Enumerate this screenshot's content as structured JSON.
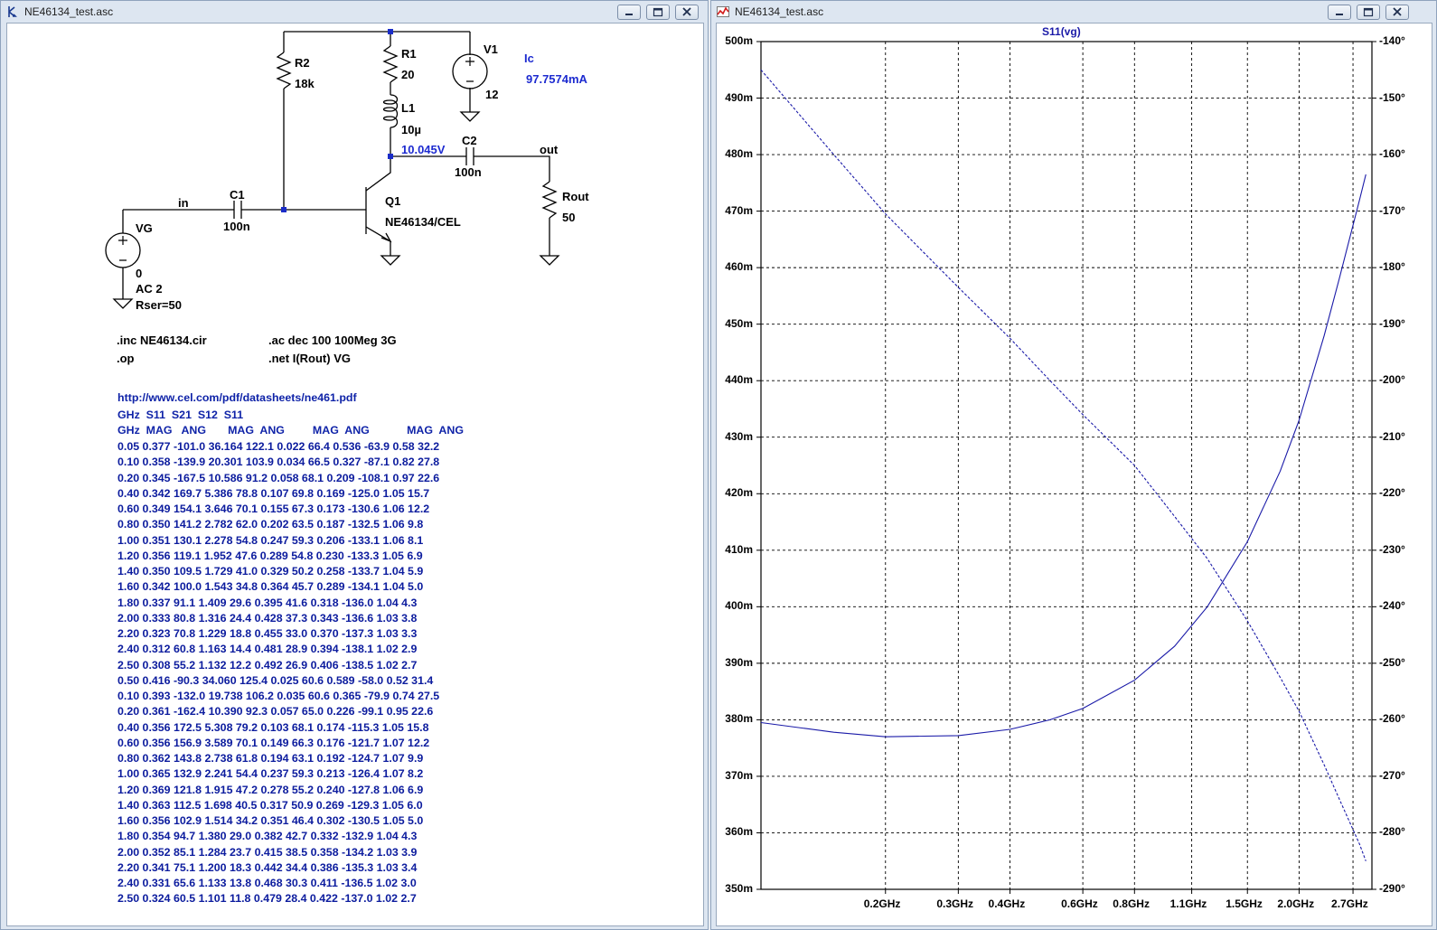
{
  "schematic_window": {
    "title": "NE46134_test.asc",
    "components": {
      "r2_name": "R2",
      "r2_value": "18k",
      "r1_name": "R1",
      "r1_value": "20",
      "v1_name": "V1",
      "v1_value": "12",
      "l1_name": "L1",
      "l1_value": "10µ",
      "c2_name": "C2",
      "c2_value": "100n",
      "c1_name": "C1",
      "c1_value": "100n",
      "q1_name": "Q1",
      "q1_model": "NE46134/CEL",
      "vg_name": "VG",
      "vg_value": "0",
      "vg_ac": "AC 2",
      "vg_rser": "Rser=50",
      "rout_name": "Rout",
      "rout_value": "50"
    },
    "net_labels": {
      "in": "in",
      "out": "out"
    },
    "op_annotations": {
      "ic_label": "Ic",
      "ic_value": "97.7574mA",
      "node_voltage": "10.045V"
    },
    "directives": {
      "inc": ".inc NE46134.cir",
      "op": ".op",
      "ac": ".ac dec 100 100Meg 3G",
      "net": ".net I(Rout) VG"
    },
    "comments": {
      "url": "http://www.cel.com/pdf/datasheets/ne461.pdf",
      "header1": "GHz  S11  S21  S12  S11",
      "header2": "GHz  MAG   ANG       MAG  ANG         MAG  ANG            MAG  ANG",
      "rows": [
        "0.05 0.377 -101.0 36.164 122.1 0.022 66.4 0.536 -63.9 0.58 32.2",
        "0.10 0.358 -139.9 20.301 103.9 0.034 66.5 0.327 -87.1 0.82 27.8",
        "0.20 0.345 -167.5 10.586 91.2 0.058 68.1 0.209 -108.1 0.97 22.6",
        "0.40 0.342 169.7 5.386 78.8 0.107 69.8 0.169 -125.0 1.05 15.7",
        "0.60 0.349 154.1 3.646 70.1 0.155 67.3 0.173 -130.6 1.06 12.2",
        "0.80 0.350 141.2 2.782 62.0 0.202 63.5 0.187 -132.5 1.06 9.8",
        "1.00 0.351 130.1 2.278 54.8 0.247 59.3 0.206 -133.1 1.06 8.1",
        "1.20 0.356 119.1 1.952 47.6 0.289 54.8 0.230 -133.3 1.05 6.9",
        "1.40 0.350 109.5 1.729 41.0 0.329 50.2 0.258 -133.7 1.04 5.9",
        "1.60 0.342 100.0 1.543 34.8 0.364 45.7 0.289 -134.1 1.04 5.0",
        "1.80 0.337 91.1 1.409 29.6 0.395 41.6 0.318 -136.0 1.04 4.3",
        "2.00 0.333 80.8 1.316 24.4 0.428 37.3 0.343 -136.6 1.03 3.8",
        "2.20 0.323 70.8 1.229 18.8 0.455 33.0 0.370 -137.3 1.03 3.3",
        "2.40 0.312 60.8 1.163 14.4 0.481 28.9 0.394 -138.1 1.02 2.9",
        "2.50 0.308 55.2 1.132 12.2 0.492 26.9 0.406 -138.5 1.02 2.7",
        "0.50 0.416 -90.3 34.060 125.4 0.025 60.6 0.589 -58.0 0.52 31.4",
        "0.10 0.393 -132.0 19.738 106.2 0.035 60.6 0.365 -79.9 0.74 27.5",
        "0.20 0.361 -162.4 10.390 92.3 0.057 65.0 0.226 -99.1 0.95 22.6",
        "0.40 0.356 172.5 5.308 79.2 0.103 68.1 0.174 -115.3 1.05 15.8",
        "0.60 0.356 156.9 3.589 70.1 0.149 66.3 0.176 -121.7 1.07 12.2",
        "0.80 0.362 143.8 2.738 61.8 0.194 63.1 0.192 -124.7 1.07 9.9",
        "1.00 0.365 132.9 2.241 54.4 0.237 59.3 0.213 -126.4 1.07 8.2",
        "1.20 0.369 121.8 1.915 47.2 0.278 55.2 0.240 -127.8 1.06 6.9",
        "1.40 0.363 112.5 1.698 40.5 0.317 50.9 0.269 -129.3 1.05 6.0",
        "1.60 0.356 102.9 1.514 34.2 0.351 46.4 0.302 -130.5 1.05 5.0",
        "1.80 0.354 94.7 1.380 29.0 0.382 42.7 0.332 -132.9 1.04 4.3",
        "2.00 0.352 85.1 1.284 23.7 0.415 38.5 0.358 -134.2 1.03 3.9",
        "2.20 0.341 75.1 1.200 18.3 0.442 34.4 0.386 -135.3 1.03 3.4",
        "2.40 0.331 65.6 1.133 13.8 0.468 30.3 0.411 -136.5 1.02 3.0",
        "2.50 0.324 60.5 1.101 11.8 0.479 28.4 0.422 -137.0 1.02 2.7"
      ]
    }
  },
  "plot_window": {
    "title": "NE46134_test.asc"
  },
  "colors": {
    "trace": "#1a1aa8",
    "grid": "#000000",
    "schematic_text_blue": "#0f23a8"
  },
  "chart_data": {
    "type": "line",
    "title": "S11(vg)",
    "x_scale": "log",
    "x_unit": "GHz",
    "xlim": [
      0.1,
      3.0
    ],
    "x_tick_labels": [
      "0.2GHz",
      "0.3GHz",
      "0.4GHz",
      "0.6GHz",
      "0.8GHz",
      "1.1GHz",
      "1.5GHz",
      "2.0GHz",
      "2.7GHz"
    ],
    "x_tick_values": [
      0.2,
      0.3,
      0.4,
      0.6,
      0.8,
      1.1,
      1.5,
      2.0,
      2.7
    ],
    "left_axis": {
      "ylim": [
        0.35,
        0.5
      ],
      "tick_labels": [
        "500m",
        "490m",
        "480m",
        "470m",
        "460m",
        "450m",
        "440m",
        "430m",
        "420m",
        "410m",
        "400m",
        "390m",
        "380m",
        "370m",
        "360m",
        "350m"
      ]
    },
    "right_axis": {
      "ylim": [
        -290,
        -140
      ],
      "tick_labels": [
        "-140°",
        "-150°",
        "-160°",
        "-170°",
        "-180°",
        "-190°",
        "-200°",
        "-210°",
        "-220°",
        "-230°",
        "-240°",
        "-250°",
        "-260°",
        "-270°",
        "-280°",
        "-290°"
      ]
    },
    "grid": true,
    "series": [
      {
        "name": "magnitude",
        "style": "solid",
        "axis": "left",
        "x": [
          0.1,
          0.15,
          0.2,
          0.3,
          0.4,
          0.5,
          0.6,
          0.8,
          1.0,
          1.2,
          1.5,
          1.8,
          2.0,
          2.3,
          2.5,
          2.8,
          2.9
        ],
        "y": [
          0.3795,
          0.3778,
          0.377,
          0.3772,
          0.3783,
          0.38,
          0.382,
          0.387,
          0.393,
          0.4,
          0.4115,
          0.424,
          0.433,
          0.448,
          0.458,
          0.472,
          0.4765
        ]
      },
      {
        "name": "phase",
        "style": "dashed",
        "axis": "right",
        "x": [
          0.1,
          0.15,
          0.2,
          0.3,
          0.4,
          0.5,
          0.6,
          0.8,
          1.0,
          1.2,
          1.5,
          1.8,
          2.0,
          2.3,
          2.5,
          2.8,
          2.9
        ],
        "y": [
          -145.0,
          -160.0,
          -170.5,
          -183.5,
          -192.5,
          -200.0,
          -206.0,
          -215.0,
          -224.0,
          -231.5,
          -242.5,
          -252.5,
          -258.5,
          -268.0,
          -274.0,
          -282.0,
          -285.0
        ]
      }
    ]
  }
}
